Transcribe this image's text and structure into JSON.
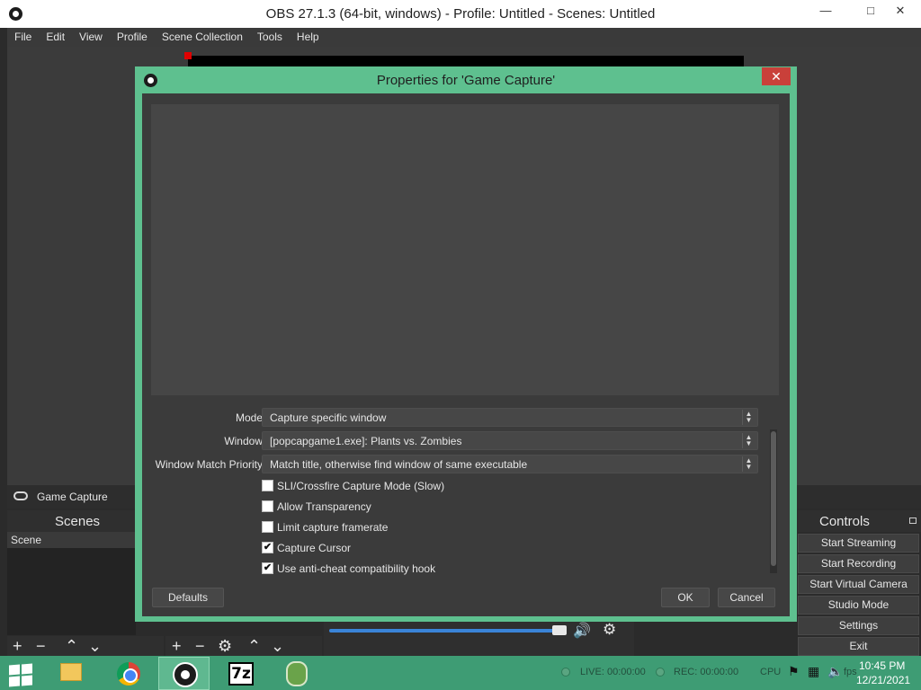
{
  "window": {
    "title": "OBS 27.1.3 (64-bit, windows) - Profile: Untitled - Scenes: Untitled",
    "minimize_glyph": "—",
    "maximize_glyph": "□",
    "close_glyph": "✕"
  },
  "menu": [
    "File",
    "Edit",
    "View",
    "Profile",
    "Scene Collection",
    "Tools",
    "Help"
  ],
  "sources": {
    "selected_source": "Game Capture"
  },
  "scenes": {
    "title": "Scenes",
    "items": [
      "Scene"
    ]
  },
  "controls": {
    "title": "Controls",
    "buttons": [
      "Start Streaming",
      "Start Recording",
      "Start Virtual Camera",
      "Studio Mode",
      "Settings",
      "Exit"
    ]
  },
  "toolbar_glyphs": {
    "add": "+",
    "remove": "−",
    "up": "⌃",
    "down": "⌄",
    "gear": "⚙",
    "speaker": "🔊"
  },
  "dialog": {
    "title": "Properties for 'Game Capture'",
    "close_glyph": "✕",
    "properties": [
      {
        "label": "Mode",
        "value": "Capture specific window"
      },
      {
        "label": "Window",
        "value": "[popcapgame1.exe]: Plants vs. Zombies"
      },
      {
        "label": "Window Match Priority",
        "value": "Match title, otherwise find window of same executable"
      }
    ],
    "checkboxes": [
      {
        "label": "SLI/Crossfire Capture Mode (Slow)",
        "checked": false
      },
      {
        "label": "Allow Transparency",
        "checked": false
      },
      {
        "label": "Limit capture framerate",
        "checked": false
      },
      {
        "label": "Capture Cursor",
        "checked": true
      },
      {
        "label": "Use anti-cheat compatibility hook",
        "checked": true
      }
    ],
    "check_glyph": "✔",
    "defaults_label": "Defaults",
    "ok_label": "OK",
    "cancel_label": "Cancel"
  },
  "status": {
    "live": "LIVE: 00:00:00",
    "rec": "REC: 00:00:00",
    "cpu_partial": "CPU",
    "fps_partial": "fps"
  },
  "taskbar": {
    "apps": [
      {
        "name": "file-explorer-icon",
        "active": false
      },
      {
        "name": "chrome-icon",
        "active": false
      },
      {
        "name": "obs-icon",
        "active": true
      },
      {
        "name": "7zip-icon",
        "active": false
      },
      {
        "name": "plants-vs-zombies-icon",
        "active": false
      }
    ],
    "sevenzip_text": "7z",
    "time": "10:45 PM",
    "date": "12/21/2021"
  },
  "colors": {
    "dialog_frame": "#5ec08f",
    "taskbar": "#3e9c74",
    "panel_bg": "#3b3b3b",
    "close_red": "#c9403a",
    "volume_blue": "#3a84d8"
  }
}
